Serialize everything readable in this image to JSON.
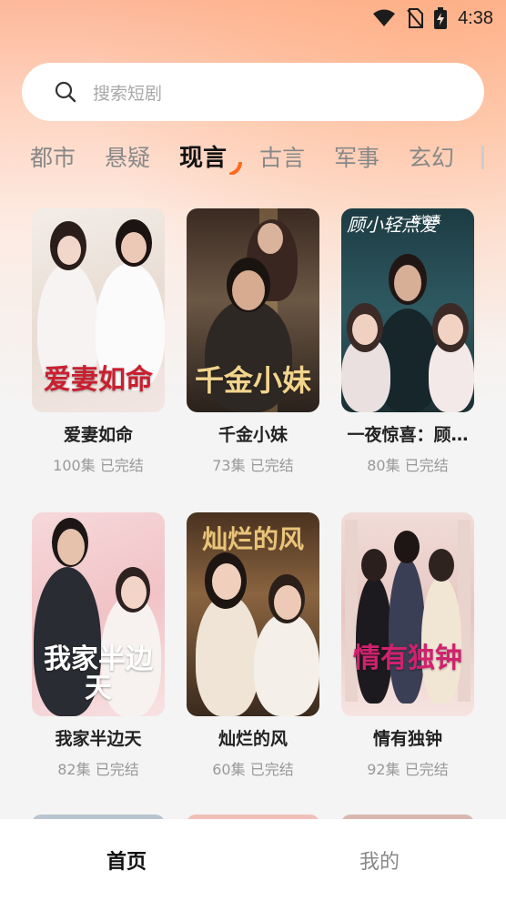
{
  "status_bar": {
    "time": "4:38"
  },
  "search": {
    "placeholder": "搜索短剧"
  },
  "tabs": [
    "都市",
    "悬疑",
    "现言",
    "古言",
    "军事",
    "玄幻"
  ],
  "active_tab": "现言",
  "colors": {
    "accent": "#ff6a1a",
    "background": "#f4f4f4"
  },
  "dramas": [
    {
      "title": "爱妻如命",
      "poster_text": "爱妻如命",
      "episodes": "100集",
      "status": "已完结"
    },
    {
      "title": "千金小妹",
      "poster_text": "千金小妹",
      "episodes": "73集",
      "status": "已完结"
    },
    {
      "title": "一夜惊喜：顾…",
      "poster_text": "顾小轻点爱",
      "poster_subtext": "一夜惊喜",
      "episodes": "80集",
      "status": "已完结"
    },
    {
      "title": "我家半边天",
      "poster_text": "我家半边天",
      "episodes": "82集",
      "status": "已完结"
    },
    {
      "title": "灿烂的风",
      "poster_text": "灿烂的风",
      "episodes": "60集",
      "status": "已完结"
    },
    {
      "title": "情有独钟",
      "poster_text": "情有独钟",
      "episodes": "92集",
      "status": "已完结"
    }
  ],
  "bottom_nav": {
    "home": "首页",
    "mine": "我的"
  }
}
